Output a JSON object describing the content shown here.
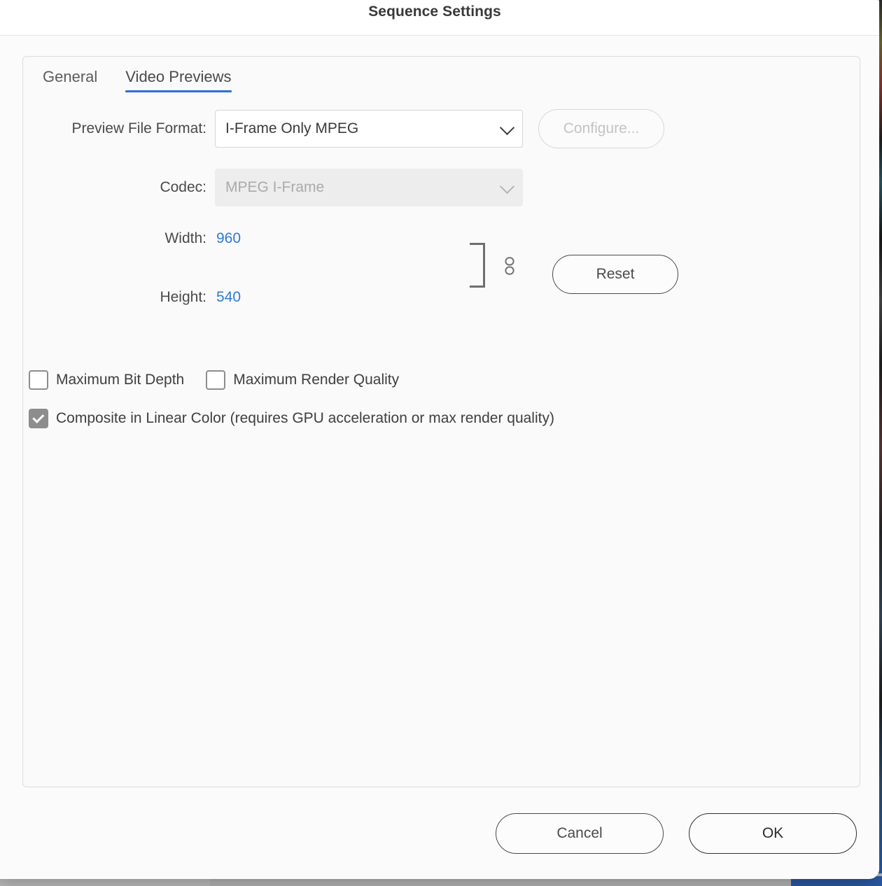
{
  "dialog": {
    "title": "Sequence Settings"
  },
  "tabs": [
    {
      "label": "General",
      "active": false
    },
    {
      "label": "Video Previews",
      "active": true
    }
  ],
  "form": {
    "preview_file_format": {
      "label": "Preview File Format:",
      "value": "I-Frame Only MPEG",
      "icon": "chevron-down-icon"
    },
    "configure_button": {
      "label": "Configure...",
      "disabled": true
    },
    "codec": {
      "label": "Codec:",
      "value": "MPEG I-Frame",
      "disabled": true,
      "icon": "chevron-down-icon"
    },
    "width": {
      "label": "Width:",
      "value": "960"
    },
    "height": {
      "label": "Height:",
      "value": "540"
    },
    "link_icon": "link-chain-icon",
    "reset_button": {
      "label": "Reset"
    }
  },
  "checkboxes": [
    {
      "label": "Maximum Bit Depth",
      "checked": false
    },
    {
      "label": "Maximum Render Quality",
      "checked": false
    },
    {
      "label": "Composite in Linear Color (requires GPU acceleration or max render quality)",
      "checked": true
    }
  ],
  "footer": {
    "cancel_label": "Cancel",
    "ok_label": "OK"
  },
  "colors": {
    "accent_blue": "#2d6fd2",
    "value_blue": "#2f7ad6",
    "checkbox_gray": "#8d8d8d",
    "title_text": "#393939",
    "label_text": "#4a4a4a"
  }
}
